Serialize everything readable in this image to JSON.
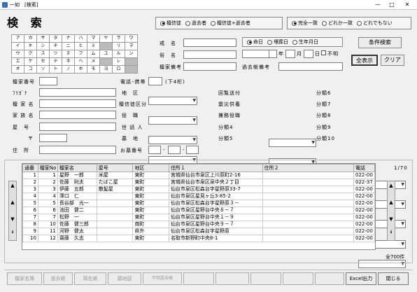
{
  "window": {
    "title": "一如　[検索]",
    "minimize": "—",
    "maximize": "□",
    "close": "✕"
  },
  "heading": "検 索",
  "mode_group": {
    "options": [
      {
        "label": "檀信徒",
        "on": true
      },
      {
        "label": "逝去者",
        "on": false
      },
      {
        "label": "檀信徒+逝去者",
        "on": false
      }
    ]
  },
  "match_group": {
    "options": [
      {
        "label": "完全一致",
        "on": true
      },
      {
        "label": "どれか一致",
        "on": false
      },
      {
        "label": "どれでもない",
        "on": false
      }
    ]
  },
  "kana": [
    [
      "ア",
      "カ",
      "サ",
      "タ",
      "ナ",
      "ハ",
      "マ",
      "ヤ",
      "ラ",
      "ワ"
    ],
    [
      "イ",
      "キ",
      "シ",
      "チ",
      "ニ",
      "ヒ",
      "ミ",
      "",
      "リ",
      "ヲ"
    ],
    [
      "ウ",
      "ク",
      "ス",
      "ツ",
      "ヌ",
      "フ",
      "ム",
      "ユ",
      "ル",
      "ン"
    ],
    [
      "エ",
      "ケ",
      "セ",
      "テ",
      "ネ",
      "ヘ",
      "メ",
      "",
      "レ",
      ""
    ],
    [
      "オ",
      "コ",
      "ソ",
      "ト",
      "ノ",
      "ホ",
      "モ",
      "ヨ",
      "ロ",
      ""
    ]
  ],
  "fields": {
    "kaimyo": "戒　名",
    "zokumyo": "俗　名",
    "danka_biko": "檀家備考",
    "kakocho_biko": "過去帳備考"
  },
  "date_group": {
    "options": [
      {
        "label": "命日",
        "on": true
      },
      {
        "label": "埋葬日",
        "on": false
      },
      {
        "label": "生年月日",
        "on": false
      }
    ]
  },
  "date_units": {
    "year": "年",
    "month": "月",
    "day": "日",
    "unknown": "不明"
  },
  "buttons": {
    "search": "条件検索",
    "show_all": "全表示",
    "clear": "クリア"
  },
  "left_labels": {
    "danka_no": "檀家番号",
    "furigana": "ﾌﾘｶﾞﾅ",
    "danka_name": "檀 家 名",
    "kazoku": "家 族 名",
    "yago": "屋　号",
    "postal": "〒",
    "address": "住　所"
  },
  "phone": {
    "label": "電話･携帯",
    "hint": "(下4桁)"
  },
  "mid_labels": {
    "chiku": "地　区",
    "kubun": "檀信徒区分",
    "yakushoku": "役　職",
    "setai": "世 話 人",
    "bochi": "墓　地",
    "haka_no": "お墓番号"
  },
  "right_labels": {
    "kaiho": "回覧送付",
    "shinsai": "震災供養",
    "kenmu": "兼務役職",
    "bunrui4": "分類4",
    "bunrui5": "分類5"
  },
  "far_labels": {
    "bunrui6": "分類6",
    "bunrui7": "分類7",
    "bunrui8": "分類8",
    "bunrui9": "分類9",
    "bunrui10": "分類10"
  },
  "page": "1/70",
  "total": "全700件",
  "table": {
    "headers": [
      "通番",
      "檀家No",
      "檀家名",
      "屋号",
      "地区",
      "住所１",
      "住所２",
      "電話"
    ],
    "rows": [
      [
        "1",
        "1",
        "星野　一郎",
        "米屋",
        "東町",
        "宮城県仙台市泉区上川原町2-16",
        "",
        "022-00"
      ],
      [
        "2",
        "2",
        "佐藤　則夫",
        "たばこ屋",
        "東町",
        "宮城県仙台市泉区泉中央２丁目",
        "",
        "022-37"
      ],
      [
        "3",
        "3",
        "伊藤　五郎",
        "散髪屋",
        "東町",
        "仙台市泉区松森台字星野原33-7",
        "",
        "022-00"
      ],
      [
        "4",
        "4",
        "澤口　仁",
        "",
        "東町",
        "仙台市泉区星見ヶ丘3-85-2",
        "",
        "022-00"
      ],
      [
        "5",
        "5",
        "長谷部　光一",
        "",
        "東町",
        "仙台市泉区松森台字星野原３－",
        "",
        "022-00"
      ],
      [
        "6",
        "6",
        "池田　健二",
        "",
        "東町",
        "仙台市泉区星野台中央８－７",
        "",
        "022-00"
      ],
      [
        "7",
        "7",
        "松野　一",
        "",
        "東町",
        "仙台市泉区星野台中央１－９",
        "",
        "022-00"
      ],
      [
        "8",
        "10",
        "佐藤　健三郎",
        "",
        "南町",
        "仙台市泉区星野台中央９－７",
        "",
        "022-00"
      ],
      [
        "9",
        "11",
        "河野　健太",
        "",
        "県外",
        "仙台市泉区松森台字星野原",
        "",
        "022-00"
      ],
      [
        "10",
        "12",
        "齋藤　久志",
        "",
        "東町",
        "名取市新野町中央8-1",
        "",
        "022-00"
      ]
    ]
  },
  "bottom": {
    "b1": "檀家名簿",
    "b2": "過去帳",
    "b3": "現在帳",
    "b4": "墓地図",
    "b5": "不明過去帳",
    "excel": "Excel出力",
    "close": "閉じる"
  }
}
